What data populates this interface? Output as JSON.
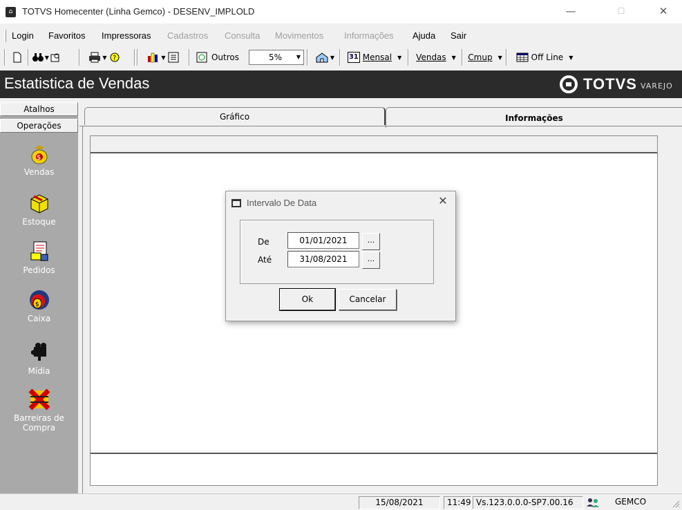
{
  "window": {
    "title": "TOTVS Homecenter (Linha Gemco) - DESENV_IMPLOLD",
    "minimize": "—",
    "maximize": "☐",
    "close": "✕"
  },
  "menu": {
    "items": [
      {
        "label": "Login",
        "enabled": true
      },
      {
        "label": "Favoritos",
        "enabled": true
      },
      {
        "label": "Impressoras",
        "enabled": true
      },
      {
        "label": "Cadastros",
        "enabled": false
      },
      {
        "label": "Consulta",
        "enabled": false
      },
      {
        "label": "Movimentos",
        "enabled": false
      },
      {
        "label": "Informações",
        "enabled": false
      },
      {
        "label": "Ajuda",
        "enabled": true
      },
      {
        "label": "Sair",
        "enabled": true
      }
    ]
  },
  "toolbar": {
    "outros_label": "Outros",
    "percent_value": "5%",
    "calendar_day": "31",
    "mensal_label": "Mensal",
    "vendas_label": "Vendas",
    "cmup_label": "Cmup",
    "offline_label": "Off Line"
  },
  "header": {
    "title": "Estatistica de Vendas",
    "brand": "TOTVS",
    "brand_sub": "VAREJO"
  },
  "sidebar": {
    "atalhos": "Atalhos",
    "operacoes": "Operações",
    "items": [
      {
        "label": "Vendas",
        "icon": "money-bag-icon"
      },
      {
        "label": "Estoque",
        "icon": "box-icon"
      },
      {
        "label": "Pedidos",
        "icon": "order-icon"
      },
      {
        "label": "Caixa",
        "icon": "cashier-icon"
      },
      {
        "label": "Mídia",
        "icon": "camera-icon"
      },
      {
        "label": "Barreiras de Compra",
        "icon": "barrier-icon"
      }
    ]
  },
  "tabs": {
    "grafico": "Gráfico",
    "informacoes": "Informações"
  },
  "dialog": {
    "title": "Intervalo De Data",
    "de_label": "De",
    "de_value": "01/01/2021",
    "ate_label": "Até",
    "ate_value": "31/08/2021",
    "ellipsis": "...",
    "ok_label": "Ok",
    "cancel_label": "Cancelar"
  },
  "status": {
    "date": "15/08/2021",
    "time": "11:49",
    "version": "Vs.123.0.0.0-SP7.00.16",
    "user": "GEMCO"
  }
}
